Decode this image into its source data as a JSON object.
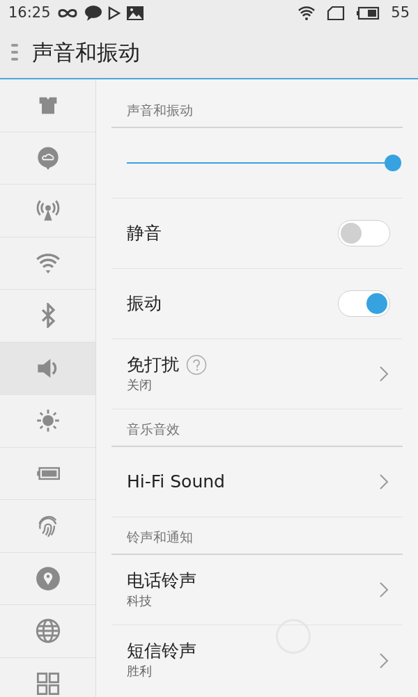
{
  "status_bar": {
    "time": "16:25",
    "battery": "55"
  },
  "header": {
    "title": "声音和振动"
  },
  "sidebar": {
    "items": [
      {
        "kind": "theme",
        "selected": false
      },
      {
        "kind": "cloud",
        "selected": false
      },
      {
        "kind": "hotspot",
        "selected": false
      },
      {
        "kind": "wifi",
        "selected": false
      },
      {
        "kind": "bluetooth",
        "selected": false
      },
      {
        "kind": "sound",
        "selected": true
      },
      {
        "kind": "brightness",
        "selected": false
      },
      {
        "kind": "battery",
        "selected": false
      },
      {
        "kind": "fingerprint",
        "selected": false
      },
      {
        "kind": "location",
        "selected": false
      },
      {
        "kind": "globe",
        "selected": false
      },
      {
        "kind": "apps",
        "selected": false
      }
    ]
  },
  "sections": [
    {
      "title": "声音和振动",
      "rows": [
        {
          "kind": "slider",
          "level": 1
        },
        {
          "kind": "toggle",
          "label": "静音",
          "on": false
        },
        {
          "kind": "toggle",
          "label": "振动",
          "on": true
        },
        {
          "kind": "link",
          "label": "免打扰",
          "help": true,
          "subtitle": "关闭"
        }
      ]
    },
    {
      "title": "音乐音效",
      "rows": [
        {
          "kind": "link",
          "label": "Hi-Fi Sound"
        }
      ]
    },
    {
      "title": "铃声和通知",
      "rows": [
        {
          "kind": "link",
          "label": "电话铃声",
          "subtitle": "科技"
        },
        {
          "kind": "link",
          "label": "短信铃声",
          "subtitle": "胜利"
        }
      ]
    }
  ]
}
